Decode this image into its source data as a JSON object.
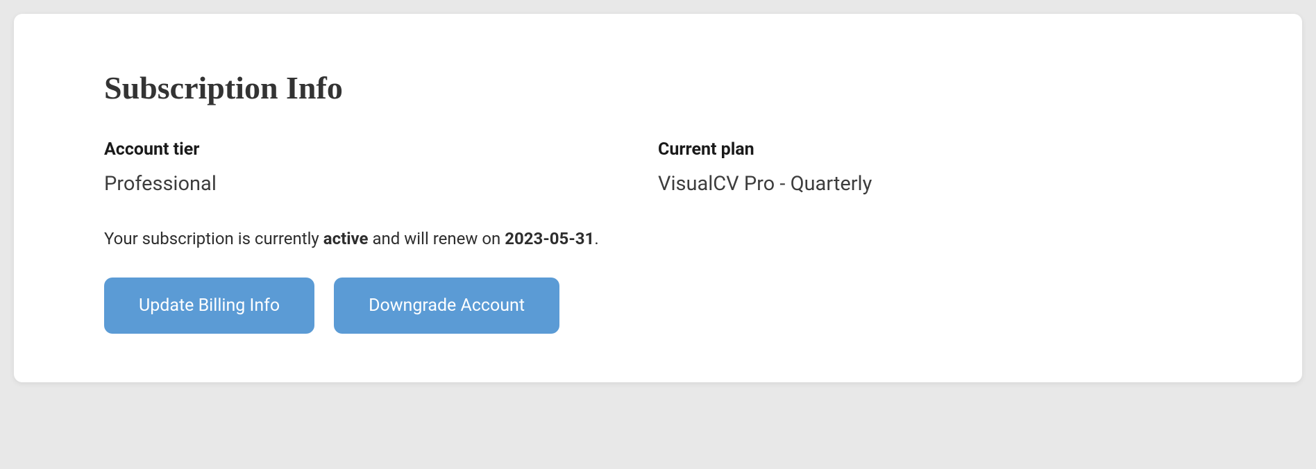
{
  "section": {
    "title": "Subscription Info"
  },
  "tier": {
    "label": "Account tier",
    "value": "Professional"
  },
  "plan": {
    "label": "Current plan",
    "value": "VisualCV Pro - Quarterly"
  },
  "status": {
    "prefix": "Your subscription is currently ",
    "state": "active",
    "middle": " and will renew on ",
    "renew_date": "2023-05-31",
    "suffix": "."
  },
  "buttons": {
    "update_billing": "Update Billing Info",
    "downgrade": "Downgrade Account"
  }
}
